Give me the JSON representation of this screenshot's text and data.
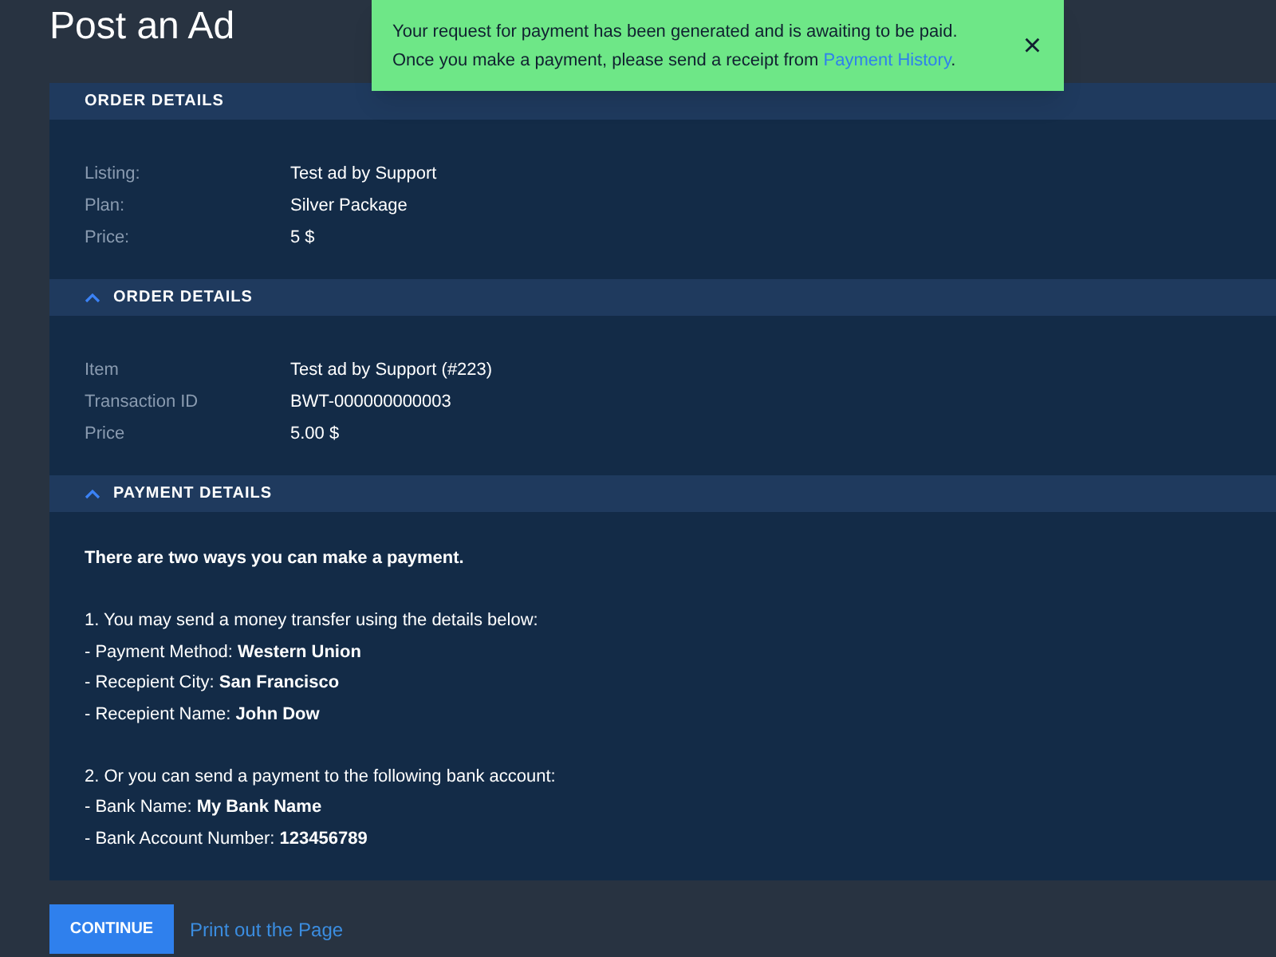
{
  "page_title": "Post an Ad",
  "toast": {
    "message": "Your request for payment has been generated and is awaiting to be paid.",
    "message_2": "Once you make a payment, please send a receipt from ",
    "link": "Payment History",
    "after_link": ".",
    "close": "×"
  },
  "sections": [
    {
      "title": "ORDER DETAILS",
      "collapsible": false,
      "expanded": true,
      "kind": "fields",
      "fields": [
        {
          "label": "Listing:",
          "value": "Test ad by Support"
        },
        {
          "label": "Plan:",
          "value": "Silver Package"
        },
        {
          "label": "Price:",
          "value": "5 $"
        }
      ]
    },
    {
      "title": "ORDER DETAILS",
      "collapsible": true,
      "expanded": true,
      "kind": "fields",
      "fields": [
        {
          "label": "Item",
          "value": "Test ad by Support (#223)"
        },
        {
          "label": "Transaction ID",
          "value": "BWT-000000000003"
        },
        {
          "label": "Price",
          "value": "5.00 $"
        }
      ]
    },
    {
      "title": "PAYMENT DETAILS",
      "collapsible": true,
      "expanded": true,
      "kind": "text",
      "groups": [
        [
          "**There are two ways you can make a payment.**"
        ],
        [
          "1. You may send a money transfer using the details below:",
          "- Payment Method: **Western Union**",
          "- Recepient City: **San Francisco**",
          "- Recepient Name: **John Dow**"
        ],
        [
          "2. Or you can send a payment to the following bank account:",
          "- Bank Name: **My Bank Name**",
          "- Bank Account Number: **123456789**"
        ]
      ]
    }
  ],
  "buttons": {
    "continue": "CONTINUE",
    "print": "Print out the Page"
  }
}
